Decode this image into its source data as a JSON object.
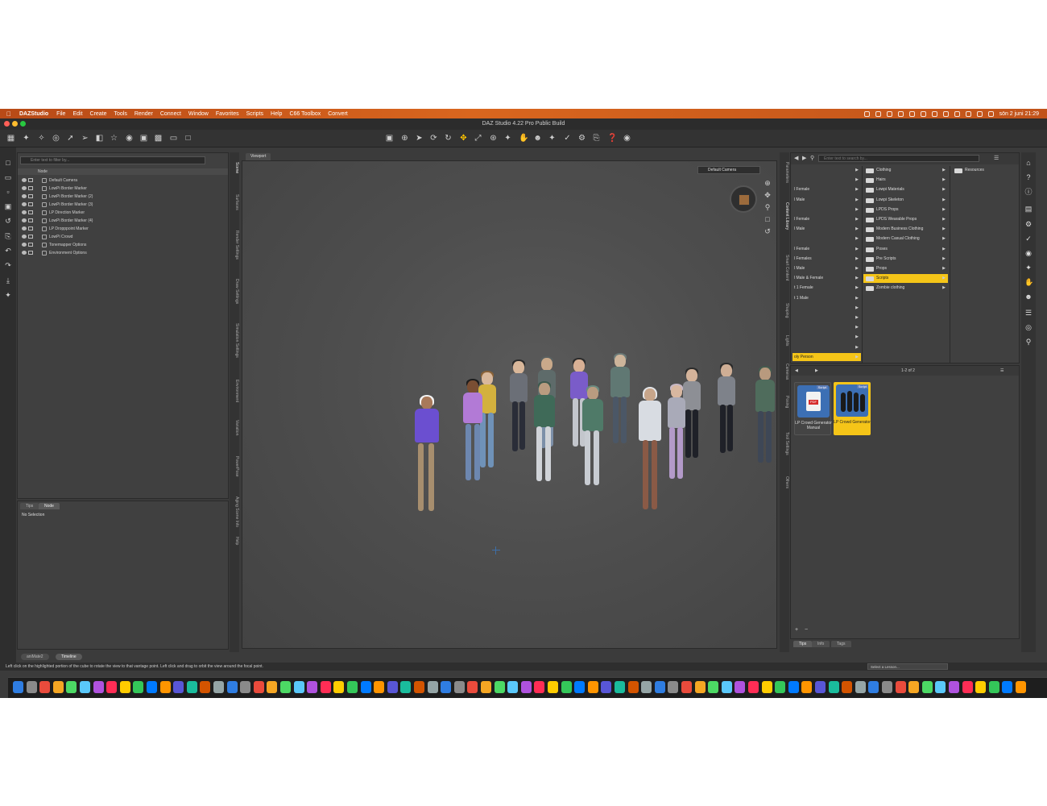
{
  "menubar": {
    "app": "DAZStudio",
    "items": [
      "File",
      "Edit",
      "Create",
      "Tools",
      "Render",
      "Connect",
      "Window",
      "Favorites",
      "Scripts",
      "Help",
      "C66 Toolbox",
      "Convert"
    ],
    "clock": "sön 2 juni 21:29"
  },
  "window": {
    "title": "DAZ Studio 4.22 Pro Public Build"
  },
  "scene": {
    "search_placeholder": "Enter text to filter by...",
    "column_node": "Node",
    "items": [
      "Default Camera",
      "LowPi Border Marker",
      "LowPi Border Marker (2)",
      "LowPi Border Marker (3)",
      "LP Direction Marker",
      "LowPi Border Marker (4)",
      "LP Dropppoint Marker",
      "LowPi Crowd",
      "Tonemapper Options",
      "Environment Options"
    ]
  },
  "tips_panel": {
    "tabs": [
      "Tips",
      "Node"
    ],
    "content": "No Selection"
  },
  "left_vtabs": [
    "Scene",
    "Surfaces",
    "Render Settings",
    "Draw Settings",
    "Simulation Settings",
    "Environment",
    "Variation",
    "PowerPose",
    "Aging Scene Info",
    "Help"
  ],
  "viewport": {
    "tab": "Viewport",
    "camera": "Default Camera"
  },
  "right_vtabs": [
    "Parameters",
    "Content Library",
    "Smart Content",
    "Shaping",
    "Lights",
    "Cameras",
    "Posing",
    "Tool Settings",
    "Others"
  ],
  "content_library": {
    "search_placeholder": "Enter text to search by...",
    "col1": [
      "",
      "",
      "l Female",
      "l Male",
      "",
      "l Female",
      "l Male",
      "",
      "l Female",
      "l Females",
      "l Male",
      "l Male & Female",
      "t 1 Female",
      "t 1 Male",
      "",
      "",
      "",
      "",
      "",
      "oly Person"
    ],
    "col1_selected": "oly Person",
    "col2": [
      "Clothing",
      "Hairs",
      "Lowpi Materials",
      "Lowpi Skeleton",
      "LPDS Props",
      "LPDS Wearable Props",
      "Modern Business Clothing",
      "Modern Casual Clothing",
      "Poses",
      "Pre Scripts",
      "Props",
      "Scripts",
      "Zombie clothing"
    ],
    "col2_selected": "Scripts",
    "col3": [
      "Resources"
    ]
  },
  "assets": {
    "page": "1-2 of 2",
    "items": [
      {
        "label": "LP Crowd Generator Manual",
        "badge": "Script",
        "icon": "pdf-icon"
      },
      {
        "label": "LP Crowd Generator",
        "badge": "Script",
        "icon": "crowd-icon"
      }
    ],
    "bottom_tabs": [
      "Tips",
      "Info",
      "Tags"
    ]
  },
  "bottom_tabs": [
    "aniMate2",
    "Timeline"
  ],
  "status": {
    "text": "Left click on the highlighted portion of the cube to rotate the view to that vantage point. Left click and drag to orbit the view around the focal point.",
    "lesson": "Select a Lesson..."
  },
  "colors": {
    "accent": "#f5c518",
    "menubar": "#c8561b",
    "panel": "#404040"
  }
}
